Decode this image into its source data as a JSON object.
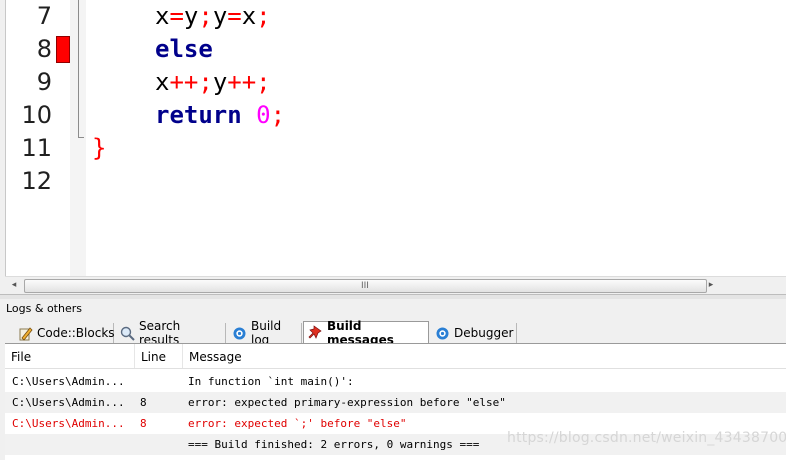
{
  "editor": {
    "lines": [
      {
        "number": "7"
      },
      {
        "number": "8",
        "breakpoint": true
      },
      {
        "number": "9"
      },
      {
        "number": "10"
      },
      {
        "number": "11"
      },
      {
        "number": "12"
      }
    ],
    "code": {
      "line7": {
        "x": "x",
        "eq": "=",
        "y": "y",
        "semi": ";",
        "y2": "y",
        "eq2": "=",
        "x2": "x",
        "semi2": ";"
      },
      "line8": {
        "kw": "else"
      },
      "line9": {
        "x": "x",
        "inc": "++;",
        "y": "y",
        "inc2": "++;"
      },
      "line10": {
        "kw": "return",
        "num": "0",
        "semi": ";"
      },
      "line11": {
        "brace": "}"
      }
    },
    "colors": {
      "keyword": "#00008b",
      "operator": "#ff0000",
      "number": "#ff00ff",
      "breakpoint": "#ff0000"
    }
  },
  "scrollbar": {
    "left_arrow": "◂",
    "right_arrow": "▸",
    "grip": "III"
  },
  "logs": {
    "title": "Logs & others",
    "tabs": [
      {
        "label": "Code::Blocks",
        "icon": "pencil-icon"
      },
      {
        "label": "Search results",
        "icon": "magnifier-icon"
      },
      {
        "label": "Build log",
        "icon": "gear-icon"
      },
      {
        "label": "Build messages",
        "icon": "pin-icon",
        "active": true
      },
      {
        "label": "Debugger",
        "icon": "gear-icon"
      }
    ],
    "columns": [
      "File",
      "Line",
      "Message"
    ],
    "rows": [
      {
        "file": "C:\\Users\\Admin...",
        "line": "",
        "message": "In function `int main()':"
      },
      {
        "file": "C:\\Users\\Admin...",
        "line": "8",
        "message": "error: expected primary-expression before \"else\""
      },
      {
        "file": "C:\\Users\\Admin...",
        "line": "8",
        "message": "error: expected `;' before \"else\""
      },
      {
        "file": "",
        "line": "",
        "message": "=== Build finished: 2 errors, 0 warnings ==="
      }
    ]
  },
  "watermark": "https://blog.csdn.net/weixin_43438700"
}
